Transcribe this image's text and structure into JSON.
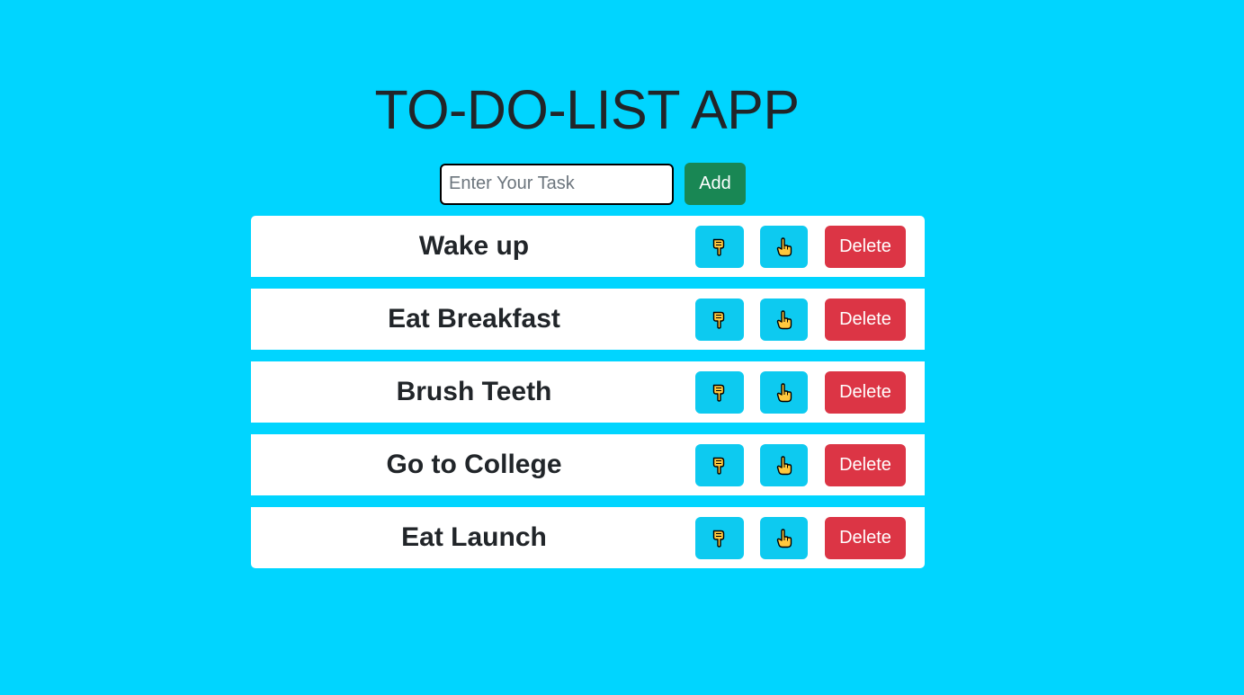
{
  "app": {
    "title": "TO-DO-LIST APP"
  },
  "input": {
    "placeholder": "Enter Your Task",
    "value": "",
    "add_label": "Add"
  },
  "tasks": [
    {
      "text": "Wake up",
      "delete_label": "Delete"
    },
    {
      "text": "Eat Breakfast",
      "delete_label": "Delete"
    },
    {
      "text": "Brush Teeth",
      "delete_label": "Delete"
    },
    {
      "text": "Go to College",
      "delete_label": "Delete"
    },
    {
      "text": "Eat Launch",
      "delete_label": "Delete"
    }
  ],
  "icons": {
    "move_down": "hand-pointing-down-icon",
    "move_up": "hand-pointing-up-icon"
  },
  "colors": {
    "background": "#00d5ff",
    "add_button": "#198754",
    "move_button": "#0dcaf0",
    "delete_button": "#dc3545",
    "hand_icon": "#ffc83d"
  }
}
